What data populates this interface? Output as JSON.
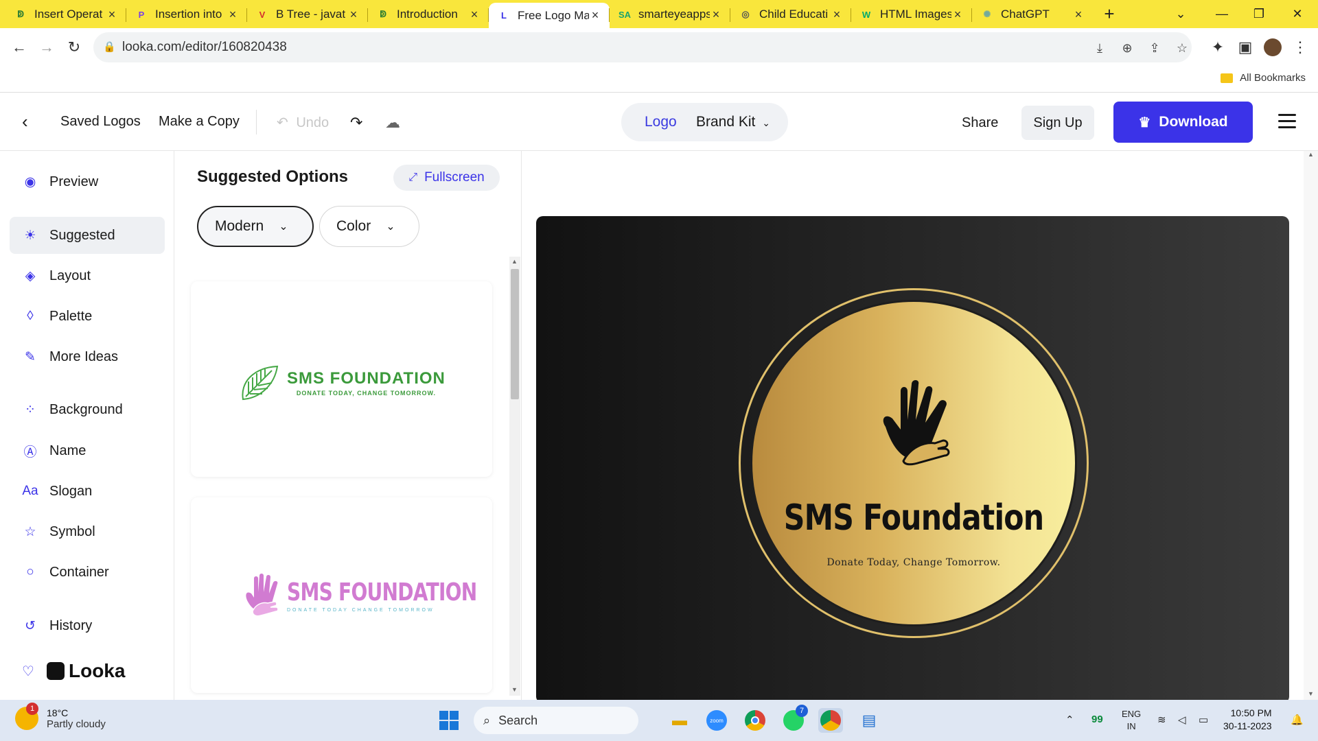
{
  "browser": {
    "tabs": [
      {
        "title": "Insert Operat",
        "icon": "javatpoint-icon",
        "fav": "ↁ",
        "color": "#2e7d32"
      },
      {
        "title": "Insertion into",
        "icon": "p-icon",
        "fav": "P",
        "color": "#7b3fe4"
      },
      {
        "title": "B Tree - javat",
        "icon": "v-shield-icon",
        "fav": "V",
        "color": "#d32f2f"
      },
      {
        "title": "Introduction",
        "icon": "javatpoint-icon",
        "fav": "ↁ",
        "color": "#2e7d32"
      },
      {
        "title": "Free Logo Ma",
        "icon": "looka-icon",
        "fav": "L",
        "color": "#3b33e8",
        "active": true
      },
      {
        "title": "smarteyeapps",
        "icon": "sa-icon",
        "fav": "SA",
        "color": "#1aa36e"
      },
      {
        "title": "Child Educati",
        "icon": "child-icon",
        "fav": "◎",
        "color": "#555"
      },
      {
        "title": "HTML Images",
        "icon": "w3schools-icon",
        "fav": "W",
        "color": "#04aa6d"
      },
      {
        "title": "ChatGPT",
        "icon": "chatgpt-icon",
        "fav": "✺",
        "color": "#74aa9c"
      }
    ],
    "url": "looka.com/editor/160820438",
    "bookmarks_label": "All Bookmarks"
  },
  "header": {
    "saved_logos": "Saved Logos",
    "make_copy": "Make a Copy",
    "undo": "Undo",
    "seg_logo": "Logo",
    "seg_brand_kit": "Brand Kit",
    "share": "Share",
    "sign_up": "Sign Up",
    "download": "Download"
  },
  "sidebar": {
    "items": [
      {
        "label": "Preview",
        "icon": "eye-icon"
      },
      {
        "label": "Suggested",
        "icon": "lightbulb-icon"
      },
      {
        "label": "Layout",
        "icon": "layers-icon"
      },
      {
        "label": "Palette",
        "icon": "droplet-icon"
      },
      {
        "label": "More Ideas",
        "icon": "wand-icon"
      },
      {
        "label": "Background",
        "icon": "grid-dots-icon"
      },
      {
        "label": "Name",
        "icon": "text-a-icon"
      },
      {
        "label": "Slogan",
        "icon": "font-aa-icon"
      },
      {
        "label": "Symbol",
        "icon": "star-icon"
      },
      {
        "label": "Container",
        "icon": "circle-icon"
      },
      {
        "label": "History",
        "icon": "history-icon"
      }
    ],
    "brand": "Looka"
  },
  "panel": {
    "title": "Suggested Options",
    "fullscreen": "Fullscreen",
    "style_filter": "Modern",
    "color_filter": "Color",
    "cards": [
      {
        "name": "SMS FOUNDATION",
        "slogan": "DONATE TODAY, CHANGE TOMORROW."
      },
      {
        "name": "SMS FOUNDATION",
        "slogan": "DONATE TODAY CHANGE TOMORROW"
      }
    ]
  },
  "canvas": {
    "name": "SMS Foundation",
    "slogan": "Donate Today, Change Tomorrow."
  },
  "taskbar": {
    "temp": "18°C",
    "weather": "Partly cloudy",
    "weather_badge": "1",
    "search": "Search",
    "whatsapp_badge": "7",
    "tray_number": "99",
    "lang1": "ENG",
    "lang2": "IN",
    "time": "10:50 PM",
    "date": "30-11-2023"
  }
}
